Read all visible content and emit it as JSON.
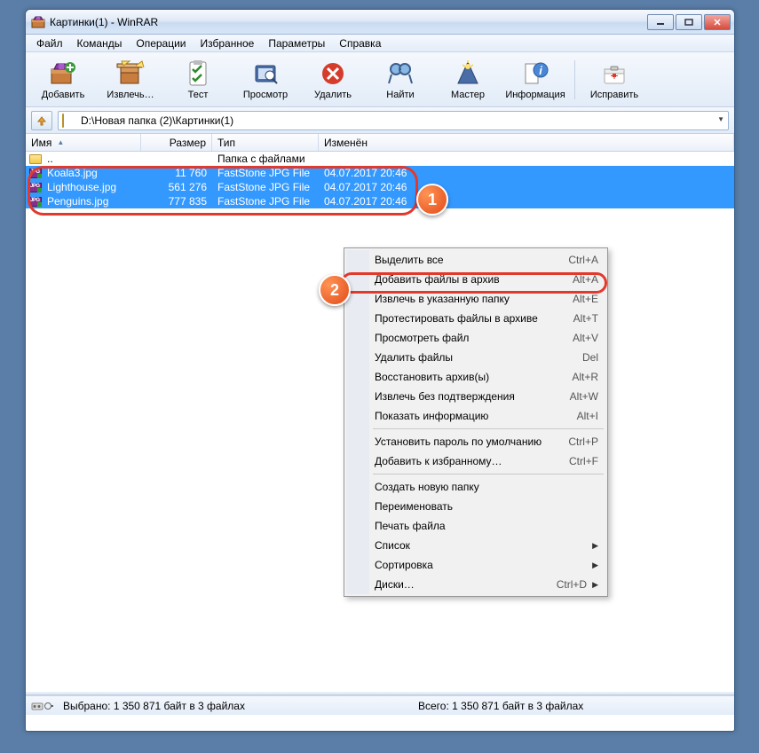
{
  "window": {
    "title": "Картинки(1) - WinRAR"
  },
  "menu": {
    "items": [
      "Файл",
      "Команды",
      "Операции",
      "Избранное",
      "Параметры",
      "Справка"
    ]
  },
  "toolbar": {
    "items": [
      {
        "label": "Добавить",
        "id": "add"
      },
      {
        "label": "Извлечь…",
        "id": "extract"
      },
      {
        "label": "Тест",
        "id": "test"
      },
      {
        "label": "Просмотр",
        "id": "view"
      },
      {
        "label": "Удалить",
        "id": "delete"
      },
      {
        "label": "Найти",
        "id": "find"
      },
      {
        "label": "Мастер",
        "id": "wizard"
      },
      {
        "label": "Информация",
        "id": "info"
      },
      {
        "label": "Исправить",
        "id": "repair"
      }
    ]
  },
  "address": {
    "path": "D:\\Новая папка (2)\\Картинки(1)"
  },
  "columns": {
    "name": "Имя",
    "size": "Размер",
    "type": "Тип",
    "modified": "Изменён"
  },
  "rows": {
    "parent": {
      "name": "..",
      "type": "Папка с файлами"
    },
    "files": [
      {
        "name": "Koala3.jpg",
        "size": "11 760",
        "type": "FastStone JPG File",
        "modified": "04.07.2017 20:46"
      },
      {
        "name": "Lighthouse.jpg",
        "size": "561 276",
        "type": "FastStone JPG File",
        "modified": "04.07.2017 20:46"
      },
      {
        "name": "Penguins.jpg",
        "size": "777 835",
        "type": "FastStone JPG File",
        "modified": "04.07.2017 20:46"
      }
    ]
  },
  "context": {
    "items": [
      {
        "label": "Выделить все",
        "shortcut": "Ctrl+A"
      },
      {
        "label": "Добавить файлы в архив",
        "shortcut": "Alt+A"
      },
      {
        "label": "Извлечь в указанную папку",
        "shortcut": "Alt+E"
      },
      {
        "label": "Протестировать файлы в архиве",
        "shortcut": "Alt+T"
      },
      {
        "label": "Просмотреть файл",
        "shortcut": "Alt+V"
      },
      {
        "label": "Удалить файлы",
        "shortcut": "Del"
      },
      {
        "label": "Восстановить архив(ы)",
        "shortcut": "Alt+R"
      },
      {
        "label": "Извлечь без подтверждения",
        "shortcut": "Alt+W"
      },
      {
        "label": "Показать информацию",
        "shortcut": "Alt+I"
      },
      {
        "sep": true
      },
      {
        "label": "Установить пароль по умолчанию",
        "shortcut": "Ctrl+P"
      },
      {
        "label": "Добавить к избранному…",
        "shortcut": "Ctrl+F"
      },
      {
        "sep": true
      },
      {
        "label": "Создать новую папку"
      },
      {
        "label": "Переименовать"
      },
      {
        "label": "Печать файла"
      },
      {
        "label": "Список",
        "sub": true
      },
      {
        "label": "Сортировка",
        "sub": true
      },
      {
        "label": "Диски…",
        "shortcut": "Ctrl+D",
        "sub": true
      }
    ]
  },
  "status": {
    "selected": "Выбрано: 1 350 871 байт в 3 файлах",
    "total": "Всего: 1 350 871 байт в 3 файлах"
  },
  "callouts": {
    "c1": "1",
    "c2": "2"
  }
}
